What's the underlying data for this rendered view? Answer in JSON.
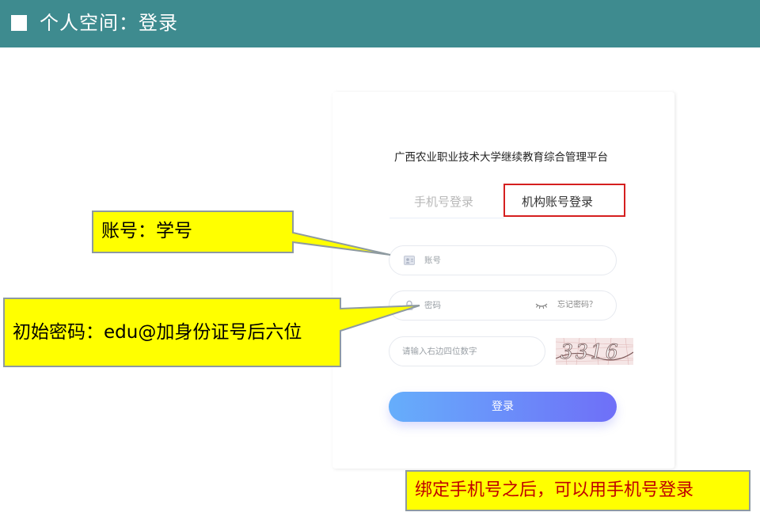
{
  "header": {
    "title": "个人空间：登录"
  },
  "login": {
    "platform_title": "广西农业职业技术大学继续教育综合管理平台",
    "tabs": {
      "phone": "手机号登录",
      "account": "机构账号登录"
    },
    "account_placeholder": "账号",
    "password_placeholder": "密码",
    "forgot_password": "忘记密码？",
    "captcha_placeholder": "请输入右边四位数字",
    "captcha_code": "3316",
    "login_button": "登录"
  },
  "callouts": {
    "account_hint": "账号：学号",
    "password_hint": "初始密码：edu@加身份证号后六位",
    "bind_note": "绑定手机号之后，可以用手机号登录"
  },
  "colors": {
    "header_bg": "#3e8b8f",
    "callout_fill": "#ffff00",
    "callout_border": "#8e9aa0",
    "highlight_red": "#d51f1f",
    "note_text": "#c00000"
  }
}
